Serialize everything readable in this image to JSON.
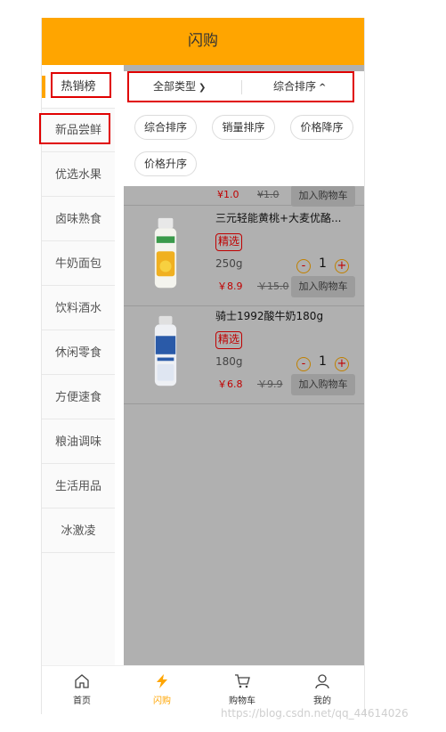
{
  "header": {
    "title": "闪购"
  },
  "sidebar": {
    "items": [
      {
        "label": "热销榜"
      },
      {
        "label": "新品尝鲜"
      },
      {
        "label": "优选水果"
      },
      {
        "label": "卤味熟食"
      },
      {
        "label": "牛奶面包"
      },
      {
        "label": "饮料酒水"
      },
      {
        "label": "休闲零食"
      },
      {
        "label": "方便速食"
      },
      {
        "label": "粮油调味"
      },
      {
        "label": "生活用品"
      },
      {
        "label": "冰激凌"
      }
    ]
  },
  "filter": {
    "type_label": "全部类型",
    "sort_label": "综合排序"
  },
  "sort_options": [
    "综合排序",
    "销量排序",
    "价格降序",
    "价格升序"
  ],
  "partial_row": {
    "price": "¥1.0",
    "orig_price": "¥1.0",
    "cart_label": "加入购物车"
  },
  "products": [
    {
      "name": "三元轻能黄桃+大麦优酪...",
      "badge": "精选",
      "weight": "250g",
      "price": "￥8.9",
      "orig_price": "￥15.0",
      "qty": "1",
      "minus": "-",
      "plus": "+",
      "cart_label": "加入购物车"
    },
    {
      "name": "骑士1992酸牛奶180g",
      "badge": "精选",
      "weight": "180g",
      "price": "￥6.8",
      "orig_price": "￥9.9",
      "qty": "1",
      "minus": "-",
      "plus": "+",
      "cart_label": "加入购物车"
    }
  ],
  "tabbar": {
    "items": [
      {
        "label": "首页",
        "icon": "home-icon",
        "color": "#333333"
      },
      {
        "label": "闪购",
        "icon": "lightning-icon",
        "color": "#FFA500"
      },
      {
        "label": "购物车",
        "icon": "cart-icon",
        "color": "#333333"
      },
      {
        "label": "我的",
        "icon": "user-icon",
        "color": "#333333"
      }
    ]
  },
  "watermark": "https://blog.csdn.net/qq_44614026",
  "colors": {
    "accent": "#FFA500",
    "price": "#c00000",
    "highlight_box": "#e00000"
  }
}
